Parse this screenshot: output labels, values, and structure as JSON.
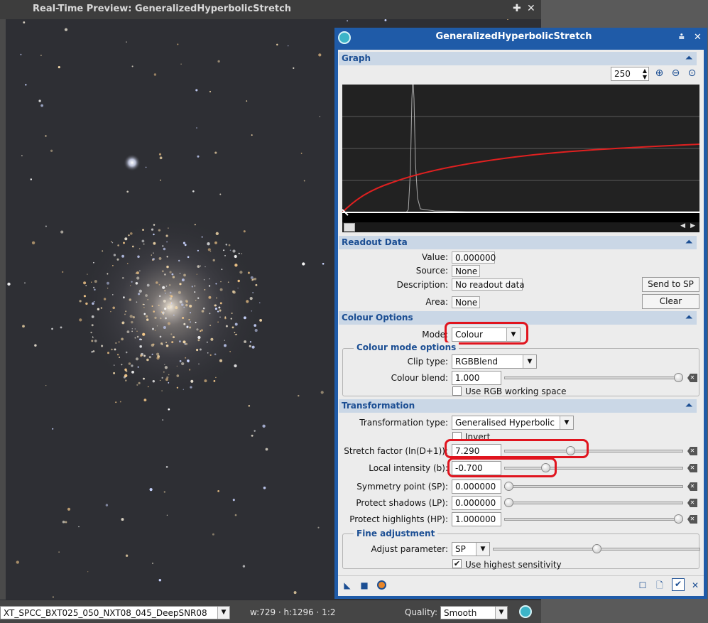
{
  "preview": {
    "title": "Real-Time Preview: GeneralizedHyperbolicStretch",
    "image_name": "XT_SPCC_BXT025_050_NXT08_045_DeepSNR08",
    "dimensions": "w:729 · h:1296 · 1:2",
    "quality_label": "Quality:",
    "quality_value": "Smooth"
  },
  "dialog": {
    "title": "GeneralizedHyperbolicStretch",
    "graph": {
      "header": "Graph",
      "zoom_value": "250",
      "tool_icons": [
        "linear-scale-icon",
        "log-scale-icon",
        "curve-icon",
        "grid-icon",
        "histogram-icon",
        "histogram-overlay-icon"
      ]
    },
    "readout": {
      "header": "Readout Data",
      "value_label": "Value:",
      "value": "0.000000",
      "source_label": "Source:",
      "source": "None",
      "description_label": "Description:",
      "description": "No readout data",
      "area_label": "Area:",
      "area": "None",
      "send_button": "Send to SP",
      "clear_button": "Clear"
    },
    "colour": {
      "header": "Colour Options",
      "mode_label": "Mode:",
      "mode_value": "Colour",
      "group_title": "Colour mode options",
      "clip_type_label": "Clip type:",
      "clip_type_value": "RGBBlend",
      "colour_blend_label": "Colour blend:",
      "colour_blend_value": "1.000",
      "colour_blend_fraction": 1.0,
      "use_rgb_label": "Use RGB working space",
      "use_rgb_checked": false
    },
    "transformation": {
      "header": "Transformation",
      "type_label": "Transformation type:",
      "type_value": "Generalised Hyperbolic",
      "invert_label": "Invert",
      "invert_checked": false,
      "params": [
        {
          "label": "Stretch factor (ln(D+1)):",
          "value": "7.290",
          "fraction": 0.37
        },
        {
          "label": "Local intensity (b):",
          "value": "-0.700",
          "fraction": 0.23
        },
        {
          "label": "Symmetry point (SP):",
          "value": "0.000000",
          "fraction": 0.0
        },
        {
          "label": "Protect shadows (LP):",
          "value": "0.000000",
          "fraction": 0.0
        },
        {
          "label": "Protect highlights (HP):",
          "value": "1.000000",
          "fraction": 1.0
        }
      ],
      "fine_title": "Fine adjustment",
      "adjust_label": "Adjust parameter:",
      "adjust_value": "SP",
      "adjust_fraction": 0.5,
      "high_sens_label": "Use highest sensitivity",
      "high_sens_checked": true
    },
    "colors": {
      "accent": "#1f5ba8",
      "highlight": "#e0141e",
      "curve": "#e02020"
    }
  }
}
